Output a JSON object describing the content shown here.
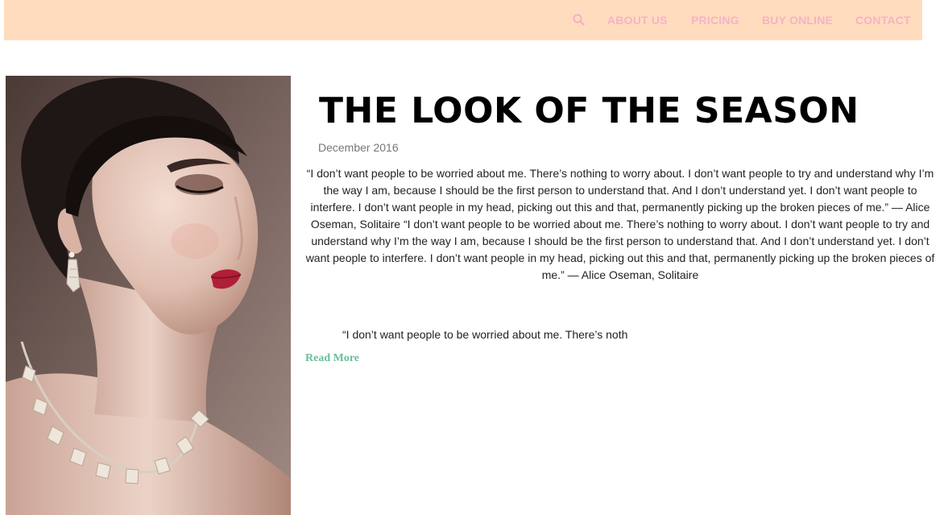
{
  "nav": {
    "search_icon": "search-icon",
    "links": [
      {
        "label": "ABOUT US"
      },
      {
        "label": "PRICING"
      },
      {
        "label": "BUY ONLINE"
      },
      {
        "label": "CONTACT"
      }
    ]
  },
  "colors": {
    "nav_background": "#ffdcbe",
    "nav_link": "#f7b2c6",
    "read_more": "#6bbf9c",
    "date": "#777777"
  },
  "post": {
    "title": "THE LOOK OF THE SEASON",
    "date": "December 2016",
    "body": "“I don’t want people to be worried about me. There’s nothing to worry about. I don’t want people to try and understand why I’m the way I am, because I should be the first person to understand that. And I don’t understand yet. I don’t want people to interfere. I don’t want people in my head, picking out this and that, permanently picking up the broken pieces of me.” — Alice Oseman, Solitaire “I don’t want people to be worried about me. There’s nothing to worry about. I don’t want people to try and understand why I’m the way I am, because I should be the first person to understand that. And I don’t understand yet. I don’t want people to interfere. I don’t want people in my head, picking out this and that, permanently picking up the broken pieces of me.” — Alice Oseman, Solitaire",
    "excerpt": "“I don’t want people to be worried about me. There’s noth",
    "read_more": "Read More"
  }
}
